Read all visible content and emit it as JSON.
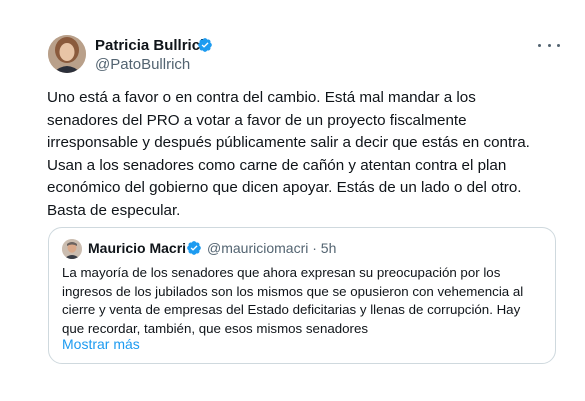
{
  "author": {
    "name": "Patricia Bullrich",
    "handle": "@PatoBullrich",
    "verified_color": "#1d9bf0"
  },
  "tweet": {
    "lines": [
      "Uno está a favor o en contra del cambio. Está mal mandar a los",
      "senadores del PRO a votar a favor de un proyecto fiscalmente",
      "irresponsable y después públicamente salir a decir que estás en contra.",
      "Usan a los senadores como carne de cañón y atentan contra el plan",
      "económico del gobierno que dicen apoyar. Estás de un lado o del otro.",
      "Basta de especular."
    ]
  },
  "quote": {
    "author_name": "Mauricio Macri",
    "handle_time": "@mauriciomacri · 5h",
    "lines": [
      "La mayoría de los senadores que ahora expresan su preocupación por los",
      "ingresos de los jubilados son los mismos que se opusieron con vehemencia al",
      "cierre y venta de empresas del Estado deficitarias y llenas de corrupción. Hay",
      "que recordar, también, que esos mismos senadores"
    ],
    "show_more": "Mostrar más"
  },
  "icons": {
    "verified": "verified-badge-icon",
    "more": "more-dots-icon"
  },
  "colors": {
    "text": "#0f1419",
    "secondary": "#536471",
    "link": "#1d9bf0",
    "border": "#cfd9de"
  }
}
